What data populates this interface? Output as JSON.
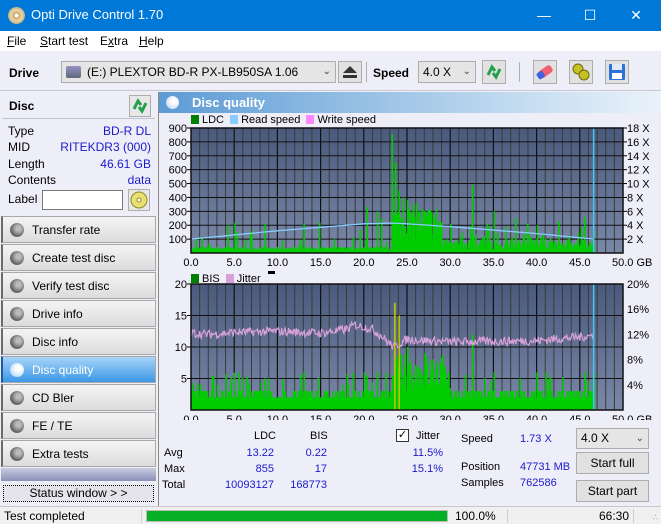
{
  "window": {
    "title": "Opti Drive Control 1.70",
    "minimize": "—",
    "maximize": "☐",
    "close": "✕"
  },
  "menu": [
    {
      "label": "File",
      "accel": "F",
      "rest": "ile"
    },
    {
      "label": "Start test",
      "accel": "S",
      "rest": "tart test"
    },
    {
      "label": "Extra",
      "accel": "E",
      "rest": "xtra",
      "accel_pos": 1
    },
    {
      "label": "Help",
      "accel": "H",
      "rest": "elp"
    }
  ],
  "toolbar": {
    "drive_label": "Drive",
    "drive_value": "(E:)  PLEXTOR BD-R  PX-LB950SA 1.06",
    "speed_label": "Speed",
    "speed_value": "4.0 X",
    "icons": [
      "drive-icon",
      "eject-icon",
      "refresh-icon",
      "erase-icon",
      "settings-icon",
      "save-icon"
    ]
  },
  "disc": {
    "header": "Disc",
    "rows": [
      {
        "key": "Type",
        "value": "BD-R DL"
      },
      {
        "key": "MID",
        "value": "RITEKDR3 (000)"
      },
      {
        "key": "Length",
        "value": "46.61 GB"
      },
      {
        "key": "Contents",
        "value": "data"
      }
    ],
    "label_key": "Label",
    "label_value": ""
  },
  "nav": [
    {
      "label": "Transfer rate",
      "active": false
    },
    {
      "label": "Create test disc",
      "active": false
    },
    {
      "label": "Verify test disc",
      "active": false
    },
    {
      "label": "Drive info",
      "active": false
    },
    {
      "label": "Disc info",
      "active": false
    },
    {
      "label": "Disc quality",
      "active": true
    },
    {
      "label": "CD Bler",
      "active": false
    },
    {
      "label": "FE / TE",
      "active": false
    },
    {
      "label": "Extra tests",
      "active": false
    }
  ],
  "status_window_button": "Status window > >",
  "panel_title": "Disc quality",
  "colors": {
    "ldc": "#008000",
    "read_speed": "#88ccff",
    "write_speed": "#ff88ff",
    "bis": "#008000",
    "jitter": "#d8a0d8",
    "bars": "#00cc00",
    "accent": "#0078d7",
    "progress": "#06b025"
  },
  "chart_data": [
    {
      "type": "bar",
      "title": "LDC / Read speed",
      "legend": [
        "LDC",
        "Read speed",
        "Write speed"
      ],
      "legend_position": "top-left",
      "xlabel": "GB",
      "xlim": [
        0,
        50
      ],
      "x_ticks": [
        "0.0",
        "5.0",
        "10.0",
        "15.0",
        "20.0",
        "25.0",
        "30.0",
        "35.0",
        "40.0",
        "45.0",
        "50.0 GB"
      ],
      "ylim_left": [
        0,
        900
      ],
      "y_ticks_left": [
        "100",
        "200",
        "300",
        "400",
        "500",
        "600",
        "700",
        "800",
        "900"
      ],
      "ylim_right": [
        0,
        18
      ],
      "y_ticks_right": [
        "2 X",
        "4 X",
        "6 X",
        "8 X",
        "10 X",
        "12 X",
        "14 X",
        "16 X",
        "18 X"
      ],
      "grid": true,
      "end_marker_gb": 46.6,
      "series": [
        {
          "name": "LDC (peaks, approx)",
          "x": [
            0.5,
            1.2,
            2.0,
            4.2,
            5.0,
            5.3,
            6.8,
            8.5,
            10.5,
            13.0,
            14.8,
            16.5,
            19.5,
            20.3,
            21.5,
            22.0,
            23.2,
            23.6,
            24.0,
            24.5,
            25.0,
            26.0,
            27.0,
            28.0,
            30.0,
            32.5,
            35.0,
            37.5,
            40.0,
            42.5,
            45.5,
            46.5
          ],
          "values": [
            100,
            120,
            70,
            200,
            220,
            150,
            160,
            210,
            90,
            210,
            220,
            100,
            170,
            330,
            300,
            250,
            855,
            650,
            450,
            400,
            380,
            360,
            300,
            280,
            210,
            490,
            300,
            250,
            200,
            230,
            260,
            150
          ]
        },
        {
          "name": "Read speed",
          "unit": "X",
          "x": [
            0,
            5,
            10,
            15,
            20,
            23.5,
            25,
            30,
            35,
            40,
            45,
            46.6
          ],
          "values": [
            2.0,
            2.6,
            3.2,
            3.7,
            4.2,
            4.3,
            4.2,
            3.8,
            3.3,
            2.8,
            2.2,
            2.0
          ]
        }
      ]
    },
    {
      "type": "bar",
      "title": "BIS / Jitter",
      "legend": [
        "BIS",
        "Jitter"
      ],
      "legend_position": "top-left",
      "xlabel": "GB",
      "xlim": [
        0,
        50
      ],
      "x_ticks": [
        "0.0",
        "5.0",
        "10.0",
        "15.0",
        "20.0",
        "25.0",
        "30.0",
        "35.0",
        "40.0",
        "45.0",
        "50.0 GB"
      ],
      "ylim_left": [
        0,
        20
      ],
      "y_ticks_left": [
        "5",
        "10",
        "15",
        "20"
      ],
      "ylim_right": [
        0,
        20
      ],
      "y_ticks_right": [
        "4%",
        "8%",
        "12%",
        "16%",
        "20%"
      ],
      "grid": true,
      "end_marker_gb": 46.6,
      "series": [
        {
          "name": "BIS (peaks, approx)",
          "x": [
            1.0,
            3.0,
            5.5,
            8.5,
            13.0,
            17.5,
            20.0,
            21.5,
            22.5,
            23.5,
            24.0,
            25.0,
            27.0,
            29.0,
            32.5,
            35.0,
            38.0,
            41.0,
            45.5,
            46.5
          ],
          "values": [
            4,
            4,
            6,
            5,
            6,
            4,
            6,
            6,
            6,
            17,
            15,
            10,
            9,
            6,
            12,
            6,
            5,
            6,
            6,
            5
          ]
        },
        {
          "name": "Jitter",
          "unit": "%",
          "x": [
            0,
            2,
            5,
            10,
            15,
            18,
            19,
            20,
            21,
            22,
            23,
            23.5,
            25,
            30,
            35,
            40,
            45,
            46.6
          ],
          "values": [
            12.2,
            12.0,
            12.3,
            12.5,
            12.2,
            12.8,
            13.5,
            13.2,
            12.8,
            11.8,
            10.5,
            10.0,
            11.2,
            10.8,
            10.9,
            11.0,
            11.6,
            11.8
          ]
        }
      ]
    }
  ],
  "stats": {
    "col_ldc": "LDC",
    "col_bis": "BIS",
    "jitter_label": "Jitter",
    "jitter_checked": true,
    "rows": [
      {
        "label": "Avg",
        "ldc": "13.22",
        "bis": "0.22",
        "jitter": "11.5%"
      },
      {
        "label": "Max",
        "ldc": "855",
        "bis": "17",
        "jitter": "15.1%"
      },
      {
        "label": "Total",
        "ldc": "10093127",
        "bis": "168773",
        "jitter": ""
      }
    ],
    "speed_label": "Speed",
    "speed_value": "1.73 X",
    "position_label": "Position",
    "position_value": "47731 MB",
    "samples_label": "Samples",
    "samples_value": "762586",
    "speed_select": "4.0 X",
    "start_full": "Start full",
    "start_part": "Start part"
  },
  "statusbar": {
    "status": "Test completed",
    "progress_percent": 100.0,
    "progress_text": "100.0%",
    "time": "66:30"
  }
}
